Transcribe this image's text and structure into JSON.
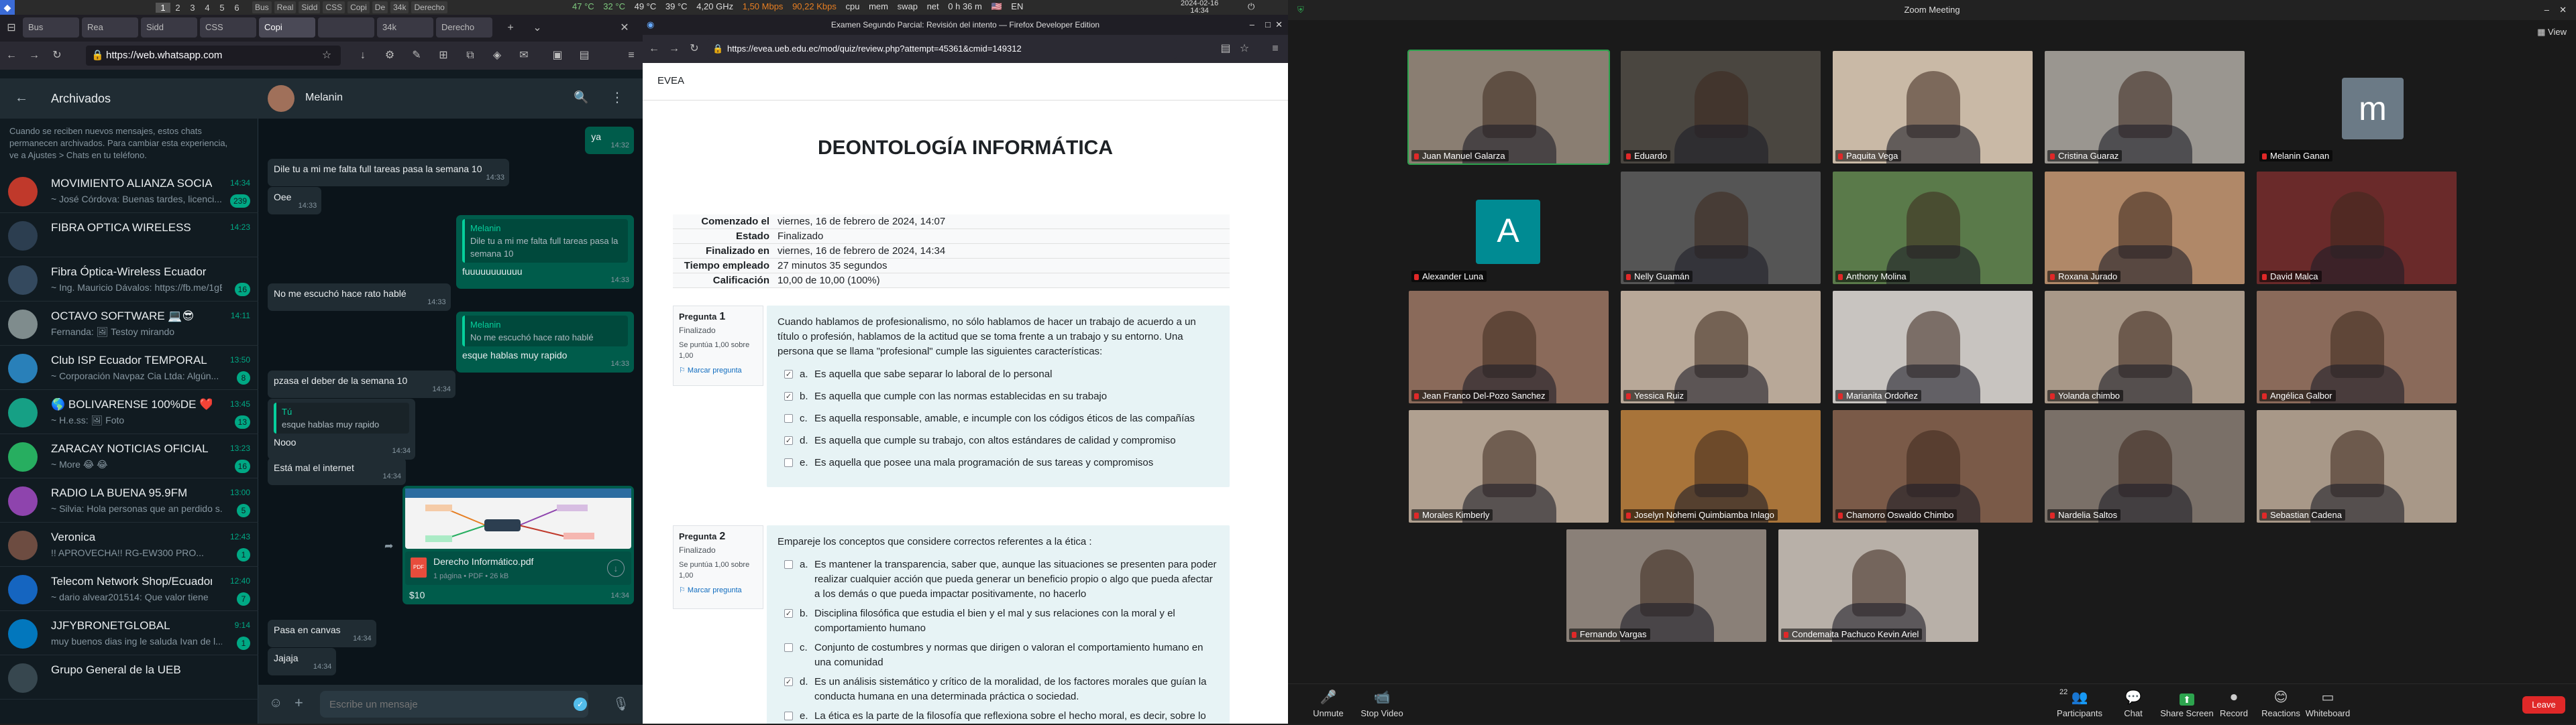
{
  "sysbar": {
    "workspaces": [
      "1",
      "2",
      "3",
      "4",
      "5",
      "6"
    ],
    "tasks": [
      "Bus",
      "Real",
      "Sidd",
      "CSS",
      "Copi",
      "De",
      "34k",
      "Derecho"
    ],
    "temp1": "47 °C",
    "temp2": "32 °C",
    "temp3": "49 °C",
    "cpu_temp": "39 °C",
    "freq": "4,20 GHz",
    "net_up": "1,50 Mbps",
    "net_down": "90,22 Kbps",
    "labels": [
      "cpu",
      "mem",
      "swap",
      "net"
    ],
    "uptime": "0 h 36 m",
    "lang": "EN",
    "date": "2024-02-16",
    "time": "14:34"
  },
  "left_browser": {
    "tabs": [
      "Bus",
      "Rea",
      "Sidd",
      "CSS",
      "Copi",
      "",
      "34k",
      "Derecho"
    ],
    "url": "https://web.whatsapp.com"
  },
  "whatsapp": {
    "archived_title": "Archivados",
    "notice": "Cuando se reciben nuevos mensajes, estos chats permanecen archivados. Para cambiar esta experiencia, ve a Ajustes > Chats en tu teléfono.",
    "chats": [
      {
        "name": "MOVIMIENTO ALIANZA SOCIAL",
        "msg": "~ José Córdova: Buenas tardes, licenci...",
        "time": "14:34",
        "badge": "239",
        "color": "#c0392b"
      },
      {
        "name": "FIBRA OPTICA WIRELESS",
        "msg": "",
        "time": "14:23",
        "badge": "",
        "color": "#2c3e50"
      },
      {
        "name": "Fibra Óptica-Wireless Ecuador",
        "msg": "~ Ing. Mauricio Dávalos: https://fb.me/1gEC...",
        "time": "",
        "badge": "16",
        "color": "#34495e"
      },
      {
        "name": "OCTAVO SOFTWARE 💻😎",
        "msg": "Fernanda: 🖼 Testoy mirando",
        "time": "14:11",
        "badge": "",
        "color": "#7f8c8d"
      },
      {
        "name": "Club ISP Ecuador TEMPORAL",
        "msg": "~ Corporación Navpaz Cia Ltda: Algún...",
        "time": "13:50",
        "badge": "8",
        "color": "#2980b9"
      },
      {
        "name": "🌎 BOLIVARENSE 100%DE ❤️",
        "msg": "~ H.e.ss: 🖼 Foto",
        "time": "13:45",
        "badge": "13",
        "color": "#16a085"
      },
      {
        "name": "ZARACAY NOTICIAS OFICIAL",
        "msg": "~ More 😂 😂",
        "time": "13:23",
        "badge": "16",
        "color": "#27ae60"
      },
      {
        "name": "RADIO LA BUENA 95.9FM",
        "msg": "~ Silvia: Hola personas que an perdido s...",
        "time": "13:00",
        "badge": "5",
        "color": "#8e44ad"
      },
      {
        "name": "Veronica",
        "msg": "!! APROVECHA!!  RG-EW300 PRO...",
        "time": "12:43",
        "badge": "1",
        "color": "#6d4c41"
      },
      {
        "name": "Telecom Network Shop/Ecuador",
        "msg": "~ dario alvear201514: Que valor tiene",
        "time": "12:40",
        "badge": "7",
        "color": "#1565c0"
      },
      {
        "name": "JJFYBRONETGLOBAL",
        "msg": "muy buenos dias ing le saluda Ivan de l...",
        "time": "9:14",
        "badge": "1",
        "color": "#0277bd"
      },
      {
        "name": "Grupo General de la UEB",
        "msg": "",
        "time": "",
        "badge": "",
        "color": "#37474f"
      }
    ],
    "contact": "Melanin",
    "messages": [
      {
        "type": "out",
        "text": "ya",
        "time": "14:32"
      },
      {
        "type": "in",
        "text": "Dile tu a mi me falta full tareas pasa la semana 10",
        "time": "14:33"
      },
      {
        "type": "in",
        "text": "Oee",
        "time": "14:33"
      },
      {
        "type": "out",
        "quote_name": "Melanin",
        "quote_text": "Dile tu a mi me falta full tareas pasa la semana 10",
        "text": "fuuuuuuuuuuu",
        "time": "14:33"
      },
      {
        "type": "in",
        "text": "No me escuchó hace rato hablé",
        "time": "14:33"
      },
      {
        "type": "out",
        "quote_name": "Melanin",
        "quote_text": "No me escuchó hace rato hablé",
        "text": "esque hablas muy rapido",
        "time": "14:33"
      },
      {
        "type": "in",
        "text": "pzasa el deber de la semana 10",
        "time": "14:34"
      },
      {
        "type": "in",
        "quote_name": "Tú",
        "quote_text": "esque hablas muy rapido",
        "text": "Nooo",
        "time": "14:34"
      },
      {
        "type": "in",
        "text": "Está mal el internet",
        "time": "14:34"
      },
      {
        "type": "out_doc",
        "doc_name": "Derecho Informático.pdf",
        "doc_meta": "1 página • PDF • 26 kB",
        "text": "$10",
        "time": "14:34"
      },
      {
        "type": "in",
        "text": "Pasa en canvas",
        "time": "14:34"
      },
      {
        "type": "in",
        "text": "Jajaja",
        "time": "14:34"
      }
    ],
    "input_placeholder": "Escribe un mensaje"
  },
  "mid_browser": {
    "title": "Examen Segundo Parcial: Revisión del intento — Firefox Developer Edition",
    "url": "https://evea.ueb.edu.ec/mod/quiz/review.php?attempt=45361&cmid=149312"
  },
  "quiz": {
    "site": "EVEA",
    "course": "DEONTOLOGÍA INFORMÁTICA",
    "summary": [
      {
        "label": "Comenzado el",
        "value": "viernes, 16 de febrero de 2024, 14:07"
      },
      {
        "label": "Estado",
        "value": "Finalizado"
      },
      {
        "label": "Finalizado en",
        "value": "viernes, 16 de febrero de 2024, 14:34"
      },
      {
        "label": "Tiempo empleado",
        "value": "27 minutos 35 segundos"
      },
      {
        "label": "Calificación",
        "value": "10,00 de 10,00 (100%)"
      }
    ],
    "questions": [
      {
        "label": "Pregunta",
        "num": "1",
        "state": "Finalizado",
        "score": "Se puntúa 1,00 sobre 1,00",
        "flag": "Marcar pregunta",
        "text": "Cuando hablamos de profesionalismo, no sólo hablamos de hacer un trabajo de acuerdo a un título o profesión, hablamos de la actitud que se toma frente a un trabajo y su entorno. Una persona que se llama \"profesional\" cumple las siguientes características:",
        "options": [
          {
            "letter": "a.",
            "text": "Es aquella que sabe separar lo laboral de lo personal",
            "checked": true
          },
          {
            "letter": "b.",
            "text": "Es aquella que cumple con las normas establecidas en su trabajo",
            "checked": true
          },
          {
            "letter": "c.",
            "text": "Es aquella responsable, amable, e incumple con los códigos éticos de las compañías",
            "checked": false
          },
          {
            "letter": "d.",
            "text": " Es aquella que cumple su trabajo, con altos estándares de calidad y compromiso",
            "checked": true
          },
          {
            "letter": "e.",
            "text": "Es aquella que posee una mala programación de sus tareas y compromisos",
            "checked": false
          }
        ]
      },
      {
        "label": "Pregunta",
        "num": "2",
        "state": "Finalizado",
        "score": "Se puntúa 1,00 sobre 1,00",
        "flag": "Marcar pregunta",
        "text": "Emparejе los conceptos que considere correctos referentes a la ética :",
        "options": [
          {
            "letter": "a.",
            "text": "Es mantener la transparencia, saber que, aunque las situaciones   se presenten para poder realizar cualquier acción que pueda generar un beneficio propio o algo que pueda afectar a los demás o que pueda impactar positivamente, no hacerlo",
            "checked": false
          },
          {
            "letter": "b.",
            "text": "Disciplina filosófica que estudia el bien y el mal y sus relaciones con la moral y el comportamiento humano",
            "checked": true
          },
          {
            "letter": "c.",
            "text": "Conjunto de costumbres y normas que dirigen o valoran el comportamiento humano en una comunidad",
            "checked": false
          },
          {
            "letter": "d.",
            "text": "Es un análisis sistemático y crítico de la moralidad, de los factores morales que guían la conducta humana en una determinada práctica o sociedad.",
            "checked": true
          },
          {
            "letter": "e.",
            "text": "La ética es la parte de la filosofía que reflexiona sobre el hecho moral, es decir, sobre lo que está bien",
            "checked": false
          }
        ]
      }
    ]
  },
  "zoom": {
    "title": "Zoom Meeting",
    "view_label": "View",
    "participants": [
      {
        "name": "Juan Manuel Galarza",
        "bg": "#8a7e72",
        "avatar": ""
      },
      {
        "name": "Eduardo",
        "bg": "#4a4640",
        "avatar": ""
      },
      {
        "name": "Paquita Vega",
        "bg": "#c9b9a6",
        "avatar": ""
      },
      {
        "name": "Cristina Guaraz",
        "bg": "#9a9690",
        "avatar": ""
      },
      {
        "name": "Melanin Ganan",
        "bg": "#1a1a1a",
        "avatar": "m"
      },
      {
        "name": "Alexander Luna",
        "bg": "#1a1a1a",
        "avatar": "A"
      },
      {
        "name": "Nelly Guamán",
        "bg": "#555555",
        "avatar": ""
      },
      {
        "name": "Anthony Molina",
        "bg": "#5a7a4a",
        "avatar": ""
      },
      {
        "name": "Roxana Jurado",
        "bg": "#b08868",
        "avatar": ""
      },
      {
        "name": "David Malca",
        "bg": "#6a2a2a",
        "avatar": ""
      },
      {
        "name": "Jean Franco Del-Pozo Sanchez",
        "bg": "#8a6a5a",
        "avatar": ""
      },
      {
        "name": "Yessica Ruiz",
        "bg": "#b8a898",
        "avatar": ""
      },
      {
        "name": "Marianita Ordoñez",
        "bg": "#c8c4c0",
        "avatar": ""
      },
      {
        "name": "Yolanda chimbo",
        "bg": "#a89888",
        "avatar": ""
      },
      {
        "name": "Angélica Galbor",
        "bg": "#8a6a5a",
        "avatar": ""
      },
      {
        "name": "Morales Kimberly",
        "bg": "#b0a090",
        "avatar": ""
      },
      {
        "name": "Joselyn Nohemi Quimbiamba Inlago",
        "bg": "#a8743a",
        "avatar": ""
      },
      {
        "name": "Chamorro Oswaldo Chimbo",
        "bg": "#7a5a48",
        "avatar": ""
      },
      {
        "name": "Nardelia Saltos",
        "bg": "#7a7068",
        "avatar": ""
      },
      {
        "name": "Sebastian Cadena",
        "bg": "#a89888",
        "avatar": ""
      },
      {
        "name": "Fernando Vargas",
        "bg": "#8a8078",
        "avatar": ""
      },
      {
        "name": "Condemaita Pachuco Kevin Ariel",
        "bg": "#b8b0a8",
        "avatar": ""
      }
    ],
    "controls": [
      {
        "icon": "🎤",
        "label": "Unmute"
      },
      {
        "icon": "📹",
        "label": "Stop Video"
      },
      {
        "icon": "👥",
        "label": "Participants"
      },
      {
        "icon": "💬",
        "label": "Chat"
      },
      {
        "icon": "⬆",
        "label": "Share Screen"
      },
      {
        "icon": "⏺",
        "label": "Record"
      },
      {
        "icon": "😊",
        "label": "Reactions"
      },
      {
        "icon": "▭",
        "label": "Whiteboard"
      }
    ],
    "participants_count": "22",
    "leave": "Leave"
  },
  "colors": {
    "whatsapp_green": "#00a884",
    "zoom_green": "#2da44e",
    "leave_red": "#e02828"
  }
}
